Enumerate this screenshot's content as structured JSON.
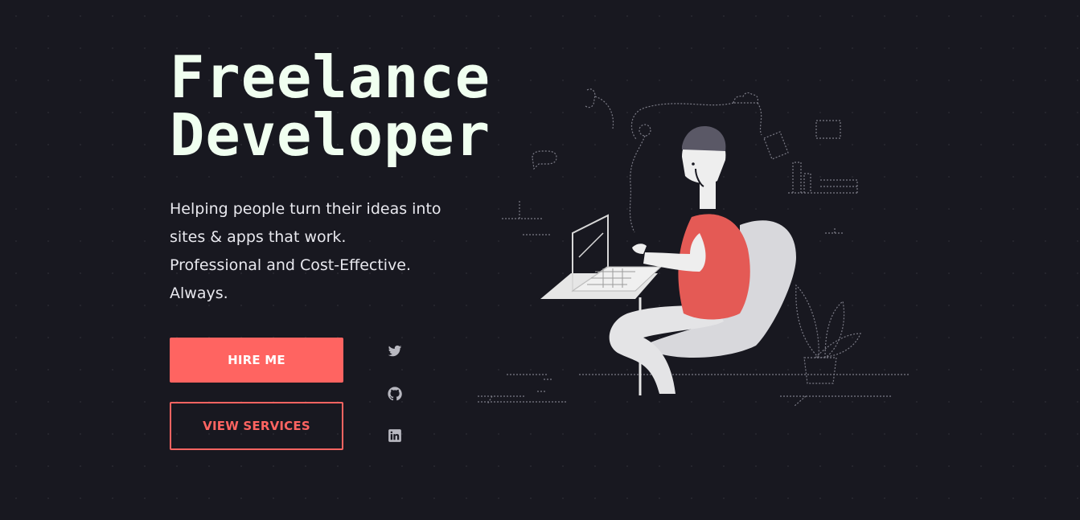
{
  "hero": {
    "title_line1": "Freelance",
    "title_line2": "Developer",
    "tagline": [
      "Helping people turn their ideas into",
      "sites & apps that work.",
      "Professional and Cost-Effective.",
      "Always."
    ]
  },
  "buttons": {
    "hire_label": "HIRE ME",
    "services_label": "VIEW SERVICES"
  },
  "social": {
    "items": [
      {
        "icon": "twitter-icon"
      },
      {
        "icon": "github-icon"
      },
      {
        "icon": "linkedin-icon"
      }
    ]
  },
  "colors": {
    "background": "#181820",
    "accent": "#ff6461",
    "title": "#f0fff0",
    "text": "#e8e8ee"
  }
}
